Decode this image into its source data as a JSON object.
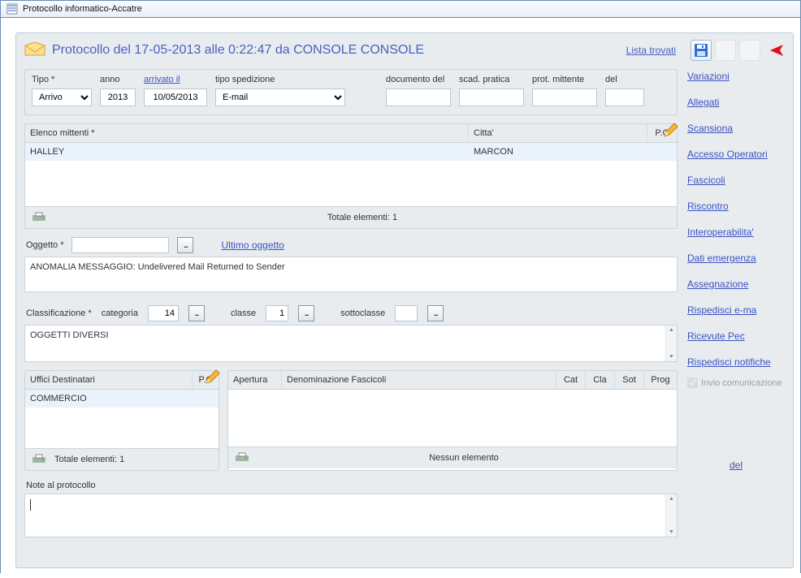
{
  "window": {
    "title": "Protocollo informatico-Accatre"
  },
  "header": {
    "title_full": "Protocollo del  17-05-2013  alle   0:22:47  da  CONSOLE CONSOLE",
    "lista_trovati": "Lista trovati"
  },
  "row1": {
    "tipo_lbl": "Tipo  *",
    "tipo_val": "Arrivo",
    "anno_lbl": "anno",
    "anno_val": "2013",
    "arrivato_lbl": "arrivato il",
    "arrivato_val": "10/05/2013",
    "sped_lbl": "tipo spedizione",
    "sped_val": "E-mail",
    "documento_lbl": "documento del",
    "scad_lbl": "scad. pratica",
    "prot_lbl": "prot. mittente",
    "del_lbl": "del"
  },
  "mittenti": {
    "header_elenco": "Elenco mittenti *",
    "header_citta": "Citta'",
    "header_pc": "P.C",
    "row_name": "HALLEY",
    "row_citta": "MARCON",
    "footer": "Totale elementi: 1"
  },
  "oggetto": {
    "lbl": "Oggetto *",
    "ultimo": "Ultimo oggetto",
    "text": "ANOMALIA MESSAGGIO: Undelivered Mail Returned to Sender"
  },
  "classif": {
    "lbl": "Classificazione *",
    "categoria_lbl": "categoria",
    "categoria_val": "14",
    "classe_lbl": "classe",
    "classe_val": "1",
    "sottoclasse_lbl": "sottoclasse",
    "text": "OGGETTI DIVERSI"
  },
  "uffici": {
    "header": "Uffici Destinatari",
    "pc": "P.C",
    "row": "COMMERCIO",
    "footer": "Totale elementi: 1"
  },
  "fascicoli": {
    "apert": "Apertura",
    "denom": "Denominazione Fascicoli",
    "cat": "Cat",
    "cla": "Cla",
    "sot": "Sot",
    "prog": "Prog",
    "footer": "Nessun elemento"
  },
  "note": {
    "lbl": "Note al protocollo"
  },
  "side": {
    "links": [
      "Variazioni",
      "Allegati",
      "Scansiona",
      "Accesso Operatori",
      "Fascicoli",
      "Riscontro",
      "Interoperabilita'",
      "Dati emergenza",
      "Assegnazione",
      "Rispedisci e-ma",
      "Ricevute Pec",
      "Rispedisci notifiche"
    ],
    "invio": "Invio comunicazione",
    "del": "del"
  }
}
